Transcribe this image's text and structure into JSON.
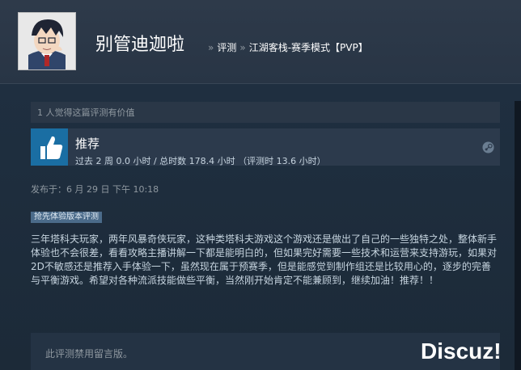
{
  "header": {
    "persona_name": "别管迪迦啦",
    "breadcrumb": [
      "评测",
      "江湖客栈-赛季模式【PVP】"
    ],
    "separator": "»"
  },
  "review": {
    "helpful_text": "1 人觉得这篇评测有价值",
    "recommendation": "推荐",
    "hours": "过去 2 周 0.0 小时 / 总时数 178.4 小时 （评测时 13.6 小时）",
    "posted": "发布于：6 月 29 日 下午 10:18",
    "early_access_badge": "抢先体验版本评测",
    "content": "三年塔科夫玩家，两年风暴奇侠玩家，这种类塔科夫游戏这个游戏还是做出了自己的一些独特之处，整体新手体验也不会很差，看看攻略主播讲解一下都是能明白的，但如果完好需要一些技术和运营来支持游玩，如果对2D不敏感还是推荐入手体验一下，虽然现在属于预赛季，但是能感觉到制作组还是比较用心的，逐步的完善与平衡游戏。希望对各种流派技能做些平衡，当然刚开始肯定不能兼顾到，继续加油！推荐！！",
    "comments_disabled": "此评测禁用留言版。"
  },
  "watermark": "Discuz!",
  "icons": {
    "thumb": "thumbs-up-icon",
    "platform": "steam-logo-icon"
  },
  "colors": {
    "background": "#1b2838",
    "thumb_bg": "#1a6ea3",
    "text": "#c6d4df",
    "muted": "#8f98a0"
  }
}
